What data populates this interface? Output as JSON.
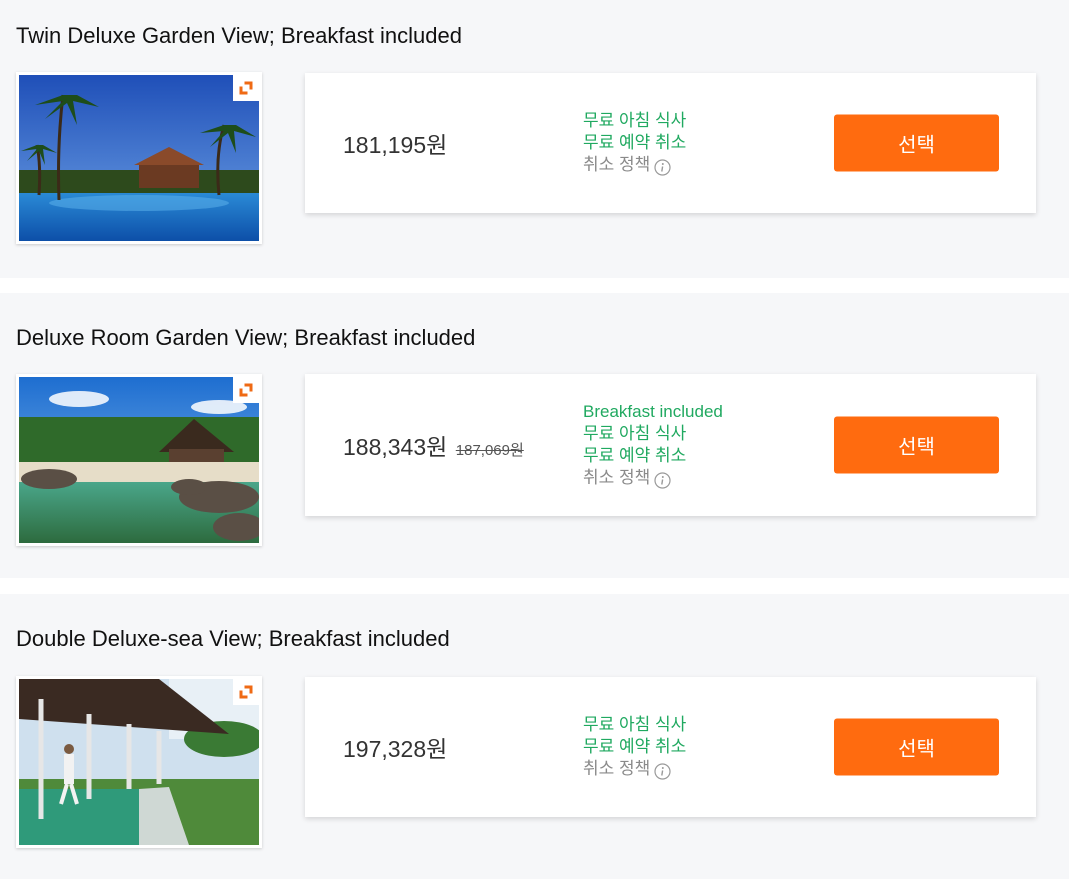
{
  "rooms": [
    {
      "title": "Twin Deluxe Garden View; Breakfast included",
      "price": "181,195원",
      "original_price": "",
      "benefits": [
        "무료 아침 식사",
        "무료 예약 취소"
      ],
      "policy": "취소 정책",
      "button": "선택"
    },
    {
      "title": "Deluxe Room Garden View; Breakfast included",
      "price": "188,343원",
      "original_price": "187,069원",
      "benefits": [
        "Breakfast included",
        "무료 아침 식사",
        "무료 예약 취소"
      ],
      "policy": "취소 정책",
      "button": "선택"
    },
    {
      "title": "Double Deluxe-sea View; Breakfast included",
      "price": "197,328원",
      "original_price": "",
      "benefits": [
        "무료 아침 식사",
        "무료 예약 취소"
      ],
      "policy": "취소 정책",
      "button": "선택"
    }
  ],
  "colors": {
    "accent": "#ff6b0f",
    "benefit": "#20a960",
    "policy": "#8a8a8a",
    "section_bg": "#f6f7f9"
  },
  "icons": {
    "expand": "expand-icon",
    "info": "info-icon"
  }
}
